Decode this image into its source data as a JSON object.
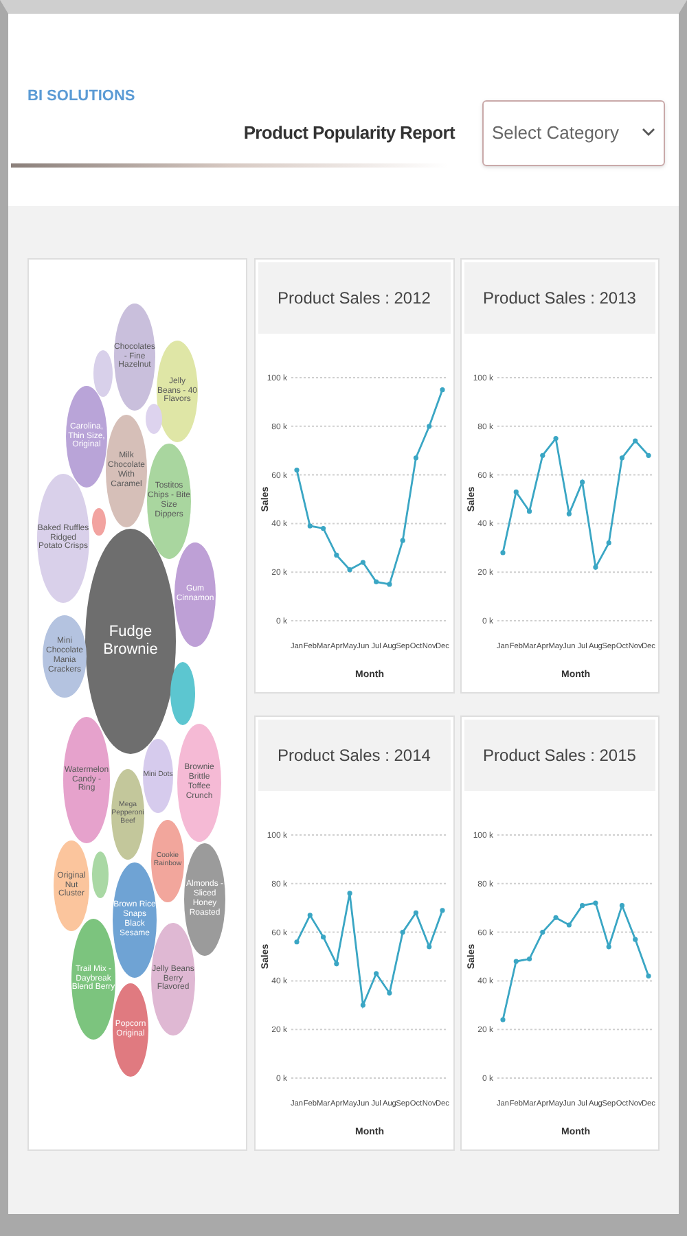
{
  "header": {
    "logo": "BI SOLUTIONS",
    "title": "Product Popularity Report",
    "category_select": {
      "placeholder": "Select Category"
    }
  },
  "bubble_chart": {
    "bubbles": [
      {
        "color": "#d8d0ea"
      },
      {
        "label": "Chocolates - Fine Hazelnut",
        "color": "#c9bfdc"
      },
      {
        "label": "Jelly Beans - 40 Flavors",
        "color": "#dfe6a6"
      },
      {
        "color": "#ddd3ee"
      },
      {
        "label": "Carolina, Thin Size, Original",
        "color": "#b9a4d8"
      },
      {
        "label": "Milk Chocolate With Caramel",
        "color": "#d6bfb8"
      },
      {
        "label": "Tostitos Chips - Bite Size Dippers",
        "color": "#a9d69f"
      },
      {
        "color": "#f2a3a0"
      },
      {
        "label": "Baked Ruffles Ridged Potato Crisps",
        "color": "#d9d0ea"
      },
      {
        "label": "Gum Cinnamon",
        "color": "#bea0d6"
      },
      {
        "label": "Fudge Brownie",
        "color": "#6e6e6e"
      },
      {
        "label": "Mini Chocolate Mania Crackers",
        "color": "#b4c3e0"
      },
      {
        "color": "#5cc6d0"
      },
      {
        "label": "Watermelon Candy - Ring",
        "color": "#e6a2cc"
      },
      {
        "label": "Mini Dots",
        "color": "#d6cbed"
      },
      {
        "label": "Brownie Brittle Toffee Crunch",
        "color": "#f5bad5"
      },
      {
        "label": "Mega Pepperoni Beef",
        "color": "#c3c79b"
      },
      {
        "label": "Cookie Rainbow",
        "color": "#f2a69c"
      },
      {
        "label": "Original Nut Cluster",
        "color": "#fbc59d"
      },
      {
        "color": "#a9d8a4"
      },
      {
        "label": "Brown Rice Snaps Black Sesame",
        "color": "#6fa3d4"
      },
      {
        "label": "Almonds - Sliced Honey Roasted",
        "color": "#9b9b9b"
      },
      {
        "label": "Trail Mix - Daybreak Blend Berry",
        "color": "#7cc47e"
      },
      {
        "label": "Jelly Beans Berry Flavored",
        "color": "#dfb8d3"
      },
      {
        "label": "Popcorn Original",
        "color": "#e07a80"
      }
    ]
  },
  "charts": [
    {
      "title": "Product Sales : 2012",
      "chart_data": {
        "type": "line",
        "xlabel": "Month",
        "ylabel": "Sales",
        "categories": [
          "Jan",
          "Feb",
          "Mar",
          "Apr",
          "May",
          "Jun",
          "Jul",
          "Aug",
          "Sep",
          "Oct",
          "Nov",
          "Dec"
        ],
        "ylim": [
          0,
          100
        ],
        "yticks": [
          {
            "value": 0,
            "label": "0 k"
          },
          {
            "value": 20,
            "label": "20 k"
          },
          {
            "value": 40,
            "label": "40 k"
          },
          {
            "value": 60,
            "label": "60 k"
          },
          {
            "value": 80,
            "label": "80 k"
          },
          {
            "value": 100,
            "label": "100 k"
          }
        ],
        "grid": true,
        "series": [
          {
            "color": "#3aa6c4",
            "marker": true,
            "values": [
              62,
              39,
              38,
              27,
              21,
              24,
              16,
              15,
              33,
              67,
              80,
              95
            ]
          }
        ]
      }
    },
    {
      "title": "Product Sales : 2013",
      "chart_data": {
        "type": "line",
        "xlabel": "Month",
        "ylabel": "Sales",
        "categories": [
          "Jan",
          "Feb",
          "Mar",
          "Apr",
          "May",
          "Jun",
          "Jul",
          "Aug",
          "Sep",
          "Oct",
          "Nov",
          "Dec"
        ],
        "ylim": [
          0,
          100
        ],
        "yticks": [
          {
            "value": 0,
            "label": "0 k"
          },
          {
            "value": 20,
            "label": "20 k"
          },
          {
            "value": 40,
            "label": "40 k"
          },
          {
            "value": 60,
            "label": "60 k"
          },
          {
            "value": 80,
            "label": "80 k"
          },
          {
            "value": 100,
            "label": "100 k"
          }
        ],
        "grid": true,
        "series": [
          {
            "color": "#3aa6c4",
            "marker": true,
            "values": [
              28,
              53,
              45,
              68,
              75,
              44,
              57,
              22,
              32,
              67,
              74,
              68
            ]
          }
        ]
      }
    },
    {
      "title": "Product Sales : 2014",
      "chart_data": {
        "type": "line",
        "xlabel": "Month",
        "ylabel": "Sales",
        "categories": [
          "Jan",
          "Feb",
          "Mar",
          "Apr",
          "May",
          "Jun",
          "Jul",
          "Aug",
          "Sep",
          "Oct",
          "Nov",
          "Dec"
        ],
        "ylim": [
          0,
          100
        ],
        "yticks": [
          {
            "value": 0,
            "label": "0 k"
          },
          {
            "value": 20,
            "label": "20 k"
          },
          {
            "value": 40,
            "label": "40 k"
          },
          {
            "value": 60,
            "label": "60 k"
          },
          {
            "value": 80,
            "label": "80 k"
          },
          {
            "value": 100,
            "label": "100 k"
          }
        ],
        "grid": true,
        "series": [
          {
            "color": "#3aa6c4",
            "marker": true,
            "values": [
              56,
              67,
              58,
              47,
              76,
              30,
              43,
              35,
              60,
              68,
              54,
              69
            ]
          }
        ]
      }
    },
    {
      "title": "Product Sales : 2015",
      "chart_data": {
        "type": "line",
        "xlabel": "Month",
        "ylabel": "Sales",
        "categories": [
          "Jan",
          "Feb",
          "Mar",
          "Apr",
          "May",
          "Jun",
          "Jul",
          "Aug",
          "Sep",
          "Oct",
          "Nov",
          "Dec"
        ],
        "ylim": [
          0,
          100
        ],
        "yticks": [
          {
            "value": 0,
            "label": "0 k"
          },
          {
            "value": 20,
            "label": "20 k"
          },
          {
            "value": 40,
            "label": "40 k"
          },
          {
            "value": 60,
            "label": "60 k"
          },
          {
            "value": 80,
            "label": "80 k"
          },
          {
            "value": 100,
            "label": "100 k"
          }
        ],
        "grid": true,
        "series": [
          {
            "color": "#3aa6c4",
            "marker": true,
            "values": [
              24,
              48,
              49,
              60,
              66,
              63,
              71,
              72,
              54,
              71,
              57,
              42
            ]
          }
        ]
      }
    }
  ]
}
